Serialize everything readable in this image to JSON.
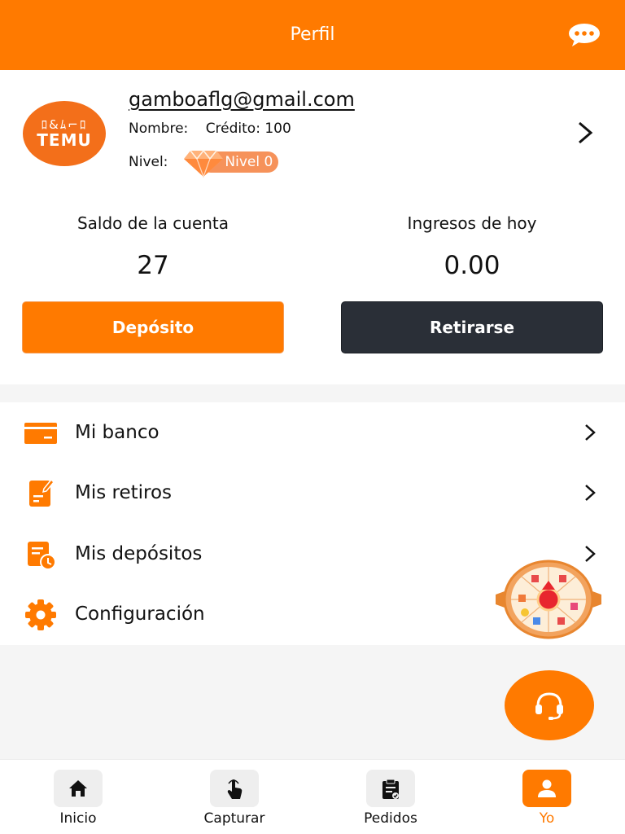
{
  "header": {
    "title": "Perfil"
  },
  "profile": {
    "avatar_glyphs": "ﾛ&ﾑ⌐ﾛ",
    "avatar_brand": "TEMU",
    "email": "gamboaflg@gmail.com",
    "name_label": "Nombre:",
    "credit_label": "Crédito: 100",
    "level_label": "Nivel:",
    "level_badge": "Nivel 0"
  },
  "stats": {
    "balance_label": "Saldo de la cuenta",
    "balance_value": "27",
    "income_label": "Ingresos de hoy",
    "income_value": "0.00"
  },
  "actions": {
    "deposit_label": "Depósito",
    "withdraw_label": "Retirarse"
  },
  "menu": {
    "items": [
      {
        "label": "Mi banco",
        "icon": "bank-card-icon"
      },
      {
        "label": "Mis retiros",
        "icon": "withdrawals-icon"
      },
      {
        "label": "Mis depósitos",
        "icon": "deposits-icon"
      },
      {
        "label": "Configuración",
        "icon": "settings-gear-icon"
      }
    ]
  },
  "tabs": [
    {
      "label": "Inicio",
      "icon": "home-icon"
    },
    {
      "label": "Capturar",
      "icon": "tap-hand-icon"
    },
    {
      "label": "Pedidos",
      "icon": "orders-clipboard-icon"
    },
    {
      "label": "Yo",
      "icon": "user-icon",
      "active": true
    }
  ],
  "colors": {
    "accent": "#ff7a00",
    "dark_button": "#2a2f37",
    "avatar": "#f36f1a",
    "level_pill": "#f6925a"
  }
}
